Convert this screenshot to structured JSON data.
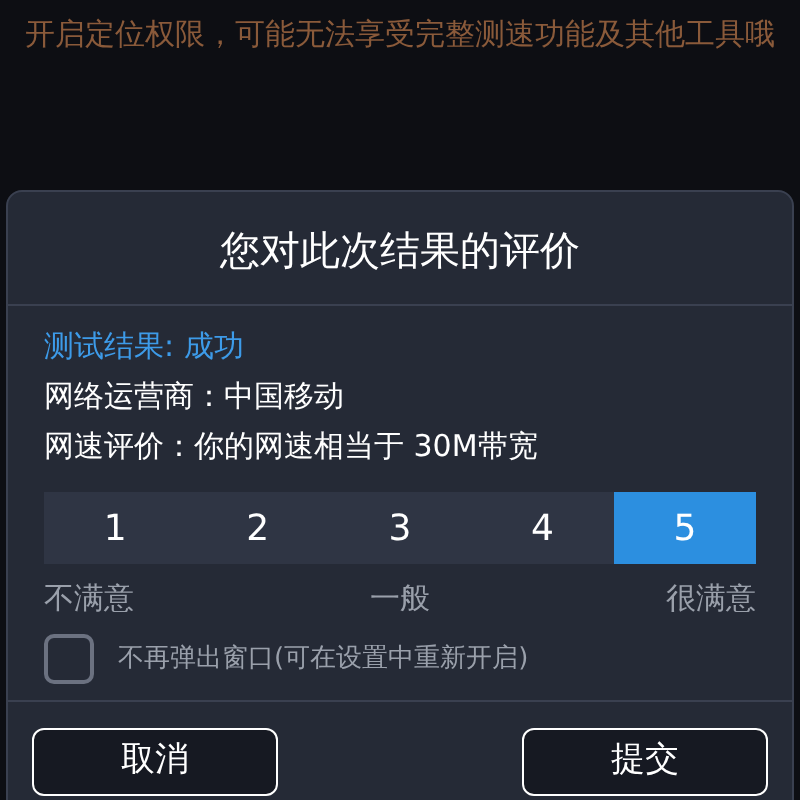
{
  "notice": "开启定位权限，可能无法享受完整测速功能及其他工具哦",
  "dialog": {
    "title": "您对此次结果的评价",
    "result": "测试结果: 成功",
    "info_lines": [
      "网络运营商：中国移动",
      "网速评价：你的网速相当于 30M带宽"
    ],
    "rating": [
      {
        "label": "1",
        "selected": false
      },
      {
        "label": "2",
        "selected": false
      },
      {
        "label": "3",
        "selected": false
      },
      {
        "label": "4",
        "selected": false
      },
      {
        "label": "5",
        "selected": true
      }
    ],
    "scale_labels": [
      "不满意",
      "一般",
      "很满意"
    ],
    "dont_show": {
      "label": "不再弹出窗口(可在设置中重新开启)",
      "checked": false
    },
    "buttons": [
      "取消",
      "提交"
    ]
  }
}
